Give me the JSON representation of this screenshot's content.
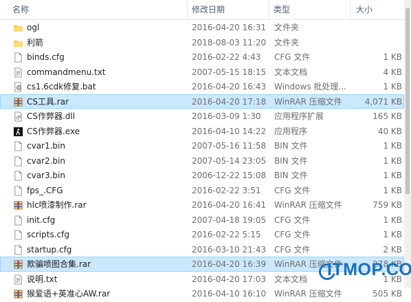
{
  "header": {
    "name": "名称",
    "date": "修改日期",
    "type": "类型",
    "size": "大小"
  },
  "files": [
    {
      "name": "ogl",
      "date": "2016-04-20 16:31",
      "type": "文件夹",
      "size": "",
      "icon": "folder-icon"
    },
    {
      "name": "利箭",
      "date": "2018-08-03 11:20",
      "type": "文件夹",
      "size": "",
      "icon": "folder-icon"
    },
    {
      "name": "binds.cfg",
      "date": "2016-02-22 4:43",
      "type": "CFG 文件",
      "size": "1 KB",
      "icon": "document-icon"
    },
    {
      "name": "commandmenu.txt",
      "date": "2007-05-15 18:15",
      "type": "文本文档",
      "size": "4 KB",
      "icon": "text-file-icon"
    },
    {
      "name": "cs1.6cdk修复.bat",
      "date": "2016-04-20 16:43",
      "type": "Windows 批处理...",
      "size": "1 KB",
      "icon": "batch-file-icon"
    },
    {
      "name": "CS工具.rar",
      "date": "2016-04-20 17:18",
      "type": "WinRAR 压缩文件",
      "size": "4,071 KB",
      "icon": "rar-archive-icon",
      "selected": true
    },
    {
      "name": "CS作弊器.dll",
      "date": "2016-03-09 1:30",
      "type": "应用程序扩展",
      "size": "165 KB",
      "icon": "dll-icon"
    },
    {
      "name": "CS作弊器.exe",
      "date": "2016-04-10 14:22",
      "type": "应用程序",
      "size": "40 KB",
      "icon": "cs-exe-icon"
    },
    {
      "name": "cvar1.bin",
      "date": "2007-05-16 11:58",
      "type": "BIN 文件",
      "size": "1 KB",
      "icon": "document-icon"
    },
    {
      "name": "cvar2.bin",
      "date": "2007-05-14 23:05",
      "type": "BIN 文件",
      "size": "1 KB",
      "icon": "document-icon"
    },
    {
      "name": "cvar3.bin",
      "date": "2006-12-22 15:08",
      "type": "BIN 文件",
      "size": "1 KB",
      "icon": "document-icon"
    },
    {
      "name": "fps_.CFG",
      "date": "2016-02-22 3:51",
      "type": "CFG 文件",
      "size": "1 KB",
      "icon": "document-icon"
    },
    {
      "name": "hlc喷漆制作.rar",
      "date": "2016-04-20 16:41",
      "type": "WinRAR 压缩文件",
      "size": "759 KB",
      "icon": "rar-archive-icon"
    },
    {
      "name": "init.cfg",
      "date": "2007-04-18 19:05",
      "type": "CFG 文件",
      "size": "1 KB",
      "icon": "document-icon"
    },
    {
      "name": "scripts.cfg",
      "date": "2016-02-22 5:15",
      "type": "CFG 文件",
      "size": "1 KB",
      "icon": "document-icon"
    },
    {
      "name": "startup.cfg",
      "date": "2016-03-10 21:43",
      "type": "CFG 文件",
      "size": "2 KB",
      "icon": "document-icon"
    },
    {
      "name": "欺骗喷图合集.rar",
      "date": "2016-04-20 16:39",
      "type": "WinRAR 压缩文件",
      "size": "278 KB",
      "icon": "rar-archive-icon",
      "selected": true
    },
    {
      "name": "说明.txt",
      "date": "2016-04-20 17:03",
      "type": "文本文档",
      "size": "1 KB",
      "icon": "text-file-icon"
    },
    {
      "name": "猴爱语+英准心AW.rar",
      "date": "2016-04-10 16:10",
      "type": "WinRAR 压缩文件",
      "size": "505 KB",
      "icon": "rar-archive-icon"
    }
  ],
  "watermark": "ITMOP.COM",
  "colors": {
    "selection": "#cce8ff",
    "selection_border": "#99d1ff",
    "folder": "#f0c35a",
    "header_text": "#4c607a",
    "watermark": "#1a6fc2"
  }
}
